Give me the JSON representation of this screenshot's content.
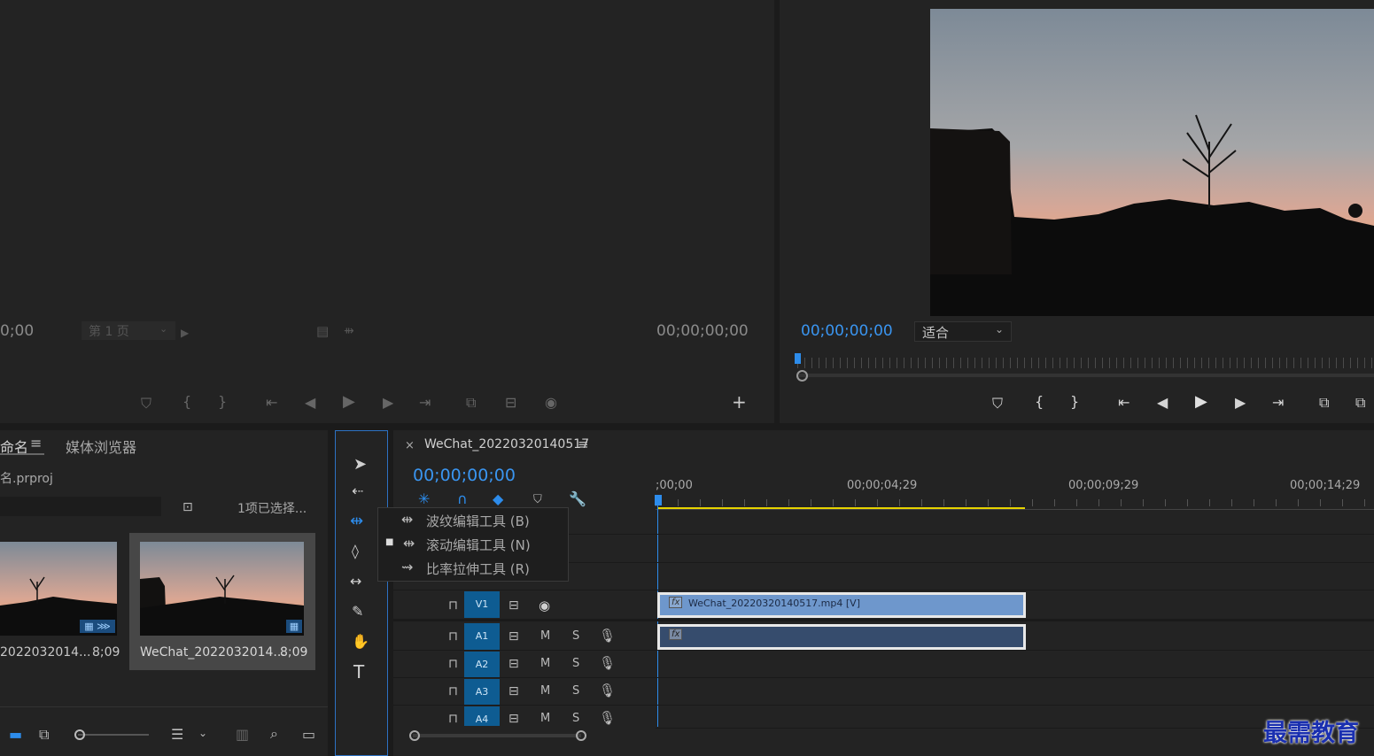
{
  "source_monitor": {
    "timecode_left": "0;00",
    "page_select": "第 1 页",
    "timecode_right": "00;00;00;00"
  },
  "program_monitor": {
    "timecode": "00;00;00;00",
    "fit_select": "适合"
  },
  "project_panel": {
    "tab_name": "命名",
    "tab_media_browser": "媒体浏览器",
    "file_name": "名.prproj",
    "selection_info": "1项已选择...",
    "items": [
      {
        "name": "2022032014...",
        "duration": "8;09"
      },
      {
        "name": "WeChat_2022032014...",
        "duration": "8;09"
      }
    ]
  },
  "tools_flyout": {
    "items": [
      {
        "label": "波纹编辑工具 (B)",
        "selected": false
      },
      {
        "label": "滚动编辑工具 (N)",
        "selected": true
      },
      {
        "label": "比率拉伸工具 (R)",
        "selected": false
      }
    ]
  },
  "timeline": {
    "tab_title": "WeChat_20220320140517",
    "timecode": "00;00;00;00",
    "ruler_labels": [
      ";00;00",
      "00;00;04;29",
      "00;00;09;29",
      "00;00;14;29"
    ],
    "tracks": {
      "v1": "V1",
      "a1": "A1",
      "a2": "A2",
      "a3": "A3",
      "a4": "A4",
      "mute": "M",
      "solo": "S"
    },
    "video_clip": {
      "fx": "fx",
      "label": "WeChat_20220320140517.mp4 [V]"
    },
    "audio_clip": {
      "fx": "fx"
    }
  },
  "watermark": "最需教育"
}
